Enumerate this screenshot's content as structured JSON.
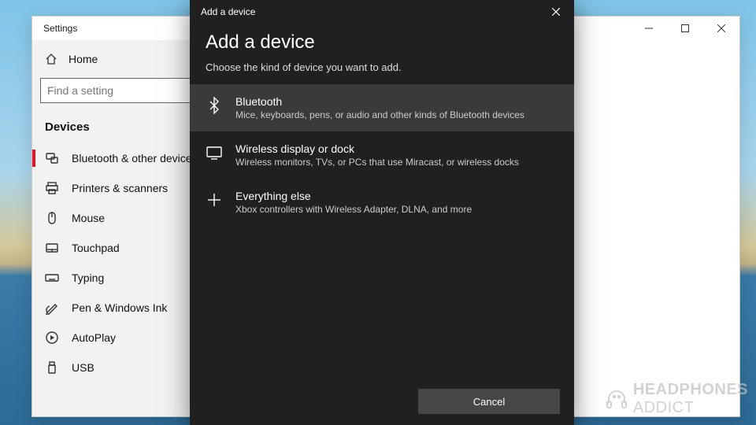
{
  "settings": {
    "title": "Settings",
    "home": "Home",
    "search_placeholder": "Find a setting",
    "section": "Devices",
    "nav": [
      {
        "label": "Bluetooth & other devices",
        "icon": "bluetooth-devices-icon",
        "active": true
      },
      {
        "label": "Printers & scanners",
        "icon": "printer-icon"
      },
      {
        "label": "Mouse",
        "icon": "mouse-icon"
      },
      {
        "label": "Touchpad",
        "icon": "touchpad-icon"
      },
      {
        "label": "Typing",
        "icon": "keyboard-icon"
      },
      {
        "label": "Pen & Windows Ink",
        "icon": "pen-icon"
      },
      {
        "label": "AutoPlay",
        "icon": "autoplay-icon"
      },
      {
        "label": "USB",
        "icon": "usb-icon"
      }
    ]
  },
  "dialog": {
    "titlebar": "Add a device",
    "heading": "Add a device",
    "subtitle": "Choose the kind of device you want to add.",
    "options": [
      {
        "title": "Bluetooth",
        "desc": "Mice, keyboards, pens, or audio and other kinds of Bluetooth devices",
        "icon": "bluetooth-icon",
        "highlight": true
      },
      {
        "title": "Wireless display or dock",
        "desc": "Wireless monitors, TVs, or PCs that use Miracast, or wireless docks",
        "icon": "display-icon"
      },
      {
        "title": "Everything else",
        "desc": "Xbox controllers with Wireless Adapter, DLNA, and more",
        "icon": "plus-icon"
      }
    ],
    "cancel": "Cancel"
  },
  "watermark": {
    "brand1": "HEADPHONES",
    "brand2": "ADDICT"
  }
}
